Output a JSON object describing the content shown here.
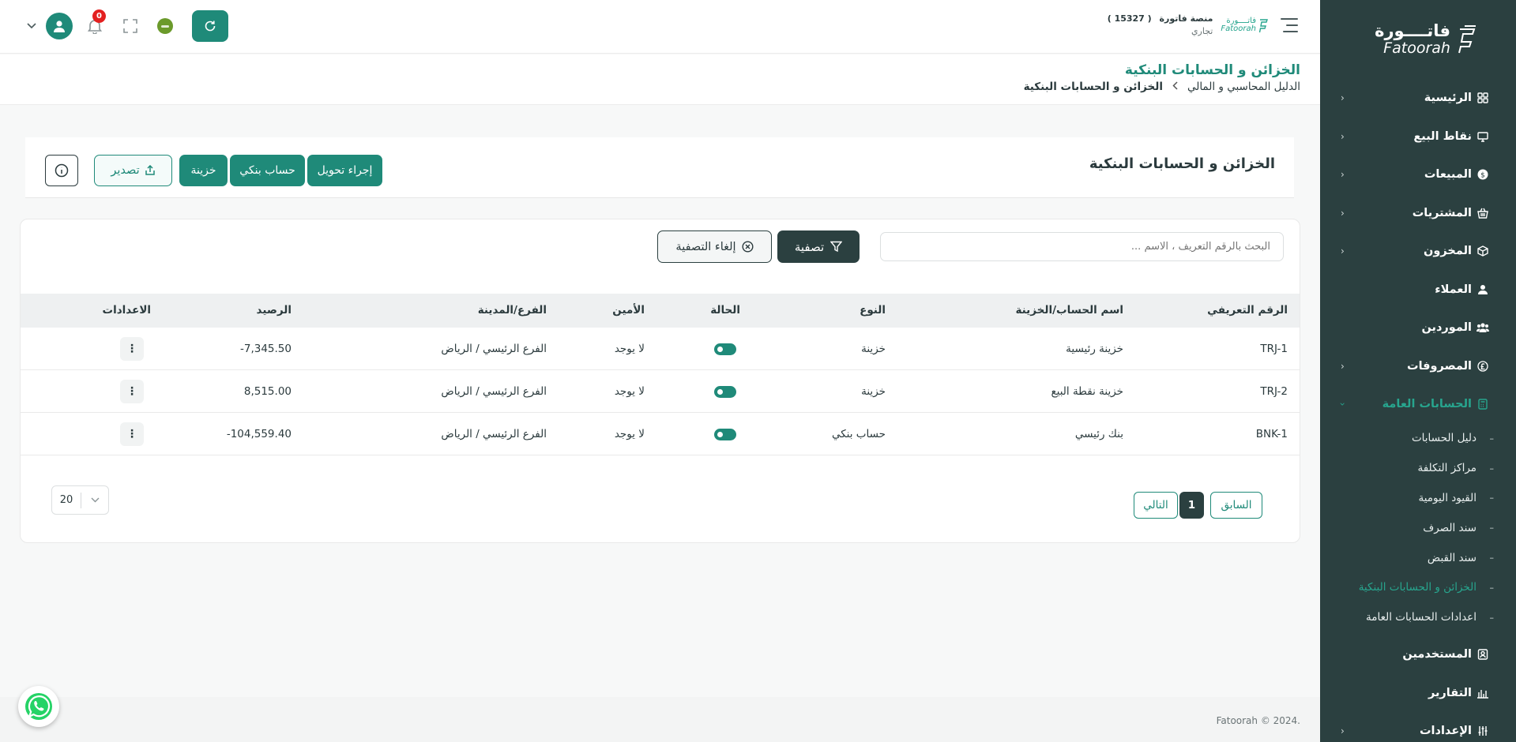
{
  "sidebar": {
    "logo": {
      "ar": "فاتــــورة",
      "en": "Fatoorah"
    },
    "items": [
      {
        "label": "الرئيسية",
        "icon": "grid-icon"
      },
      {
        "label": "نقاط البيع",
        "icon": "monitor-icon"
      },
      {
        "label": "المبيعات",
        "icon": "dollar-icon"
      },
      {
        "label": "المشتريات",
        "icon": "basket-icon"
      },
      {
        "label": "المخزون",
        "icon": "box-icon"
      },
      {
        "label": "العملاء",
        "icon": "user-icon"
      },
      {
        "label": "الموردين",
        "icon": "users-icon"
      },
      {
        "label": "المصروفات",
        "icon": "pound-icon"
      },
      {
        "label": "الحسابات العامة",
        "icon": "calculator-icon"
      },
      {
        "label": "المستخدمين",
        "icon": "user-badge-icon"
      },
      {
        "label": "التقارير",
        "icon": "chart-icon"
      },
      {
        "label": "الإعدادات",
        "icon": "sliders-icon"
      }
    ],
    "sub_items": [
      "دليل الحسابات",
      "مراكز التكلفة",
      "القيود اليومية",
      "سند الصرف",
      "سند القبض",
      "الخزائن و الحسابات البنكية",
      "اعدادات الحسابات العامة"
    ],
    "active_sub": "الخزائن و الحسابات البنكية"
  },
  "topbar": {
    "notifications_count": "0",
    "company_name": "منصة فاتورة",
    "company_id": "( 15327 )",
    "company_type": "تجاري",
    "mini_logo_ar": "فاتــــورة",
    "mini_logo_en": "Fatoorah"
  },
  "page": {
    "title": "الخزائن و الحسابات البنكية",
    "breadcrumb": [
      "الدليل المحاسبي و المالي",
      "الخزائن و الحسابات البنكية"
    ]
  },
  "card": {
    "title": "الخزائن و الحسابات البنكية",
    "buttons": {
      "transfer": "إجراء تحويل",
      "bank_account": "حساب بنكي",
      "treasury": "خزينة",
      "export": "تصدير"
    }
  },
  "filters": {
    "search_placeholder": "البحث بالرقم التعريف ، الاسم ...",
    "filter_label": "تصفية",
    "clear_label": "إلغاء التصفية"
  },
  "table": {
    "headers": [
      "الرقم التعريفي",
      "اسم الحساب/الخزينة",
      "النوع",
      "الحالة",
      "الأمين",
      "الفرع/المدينة",
      "الرصيد",
      "الاعدادات"
    ],
    "rows": [
      {
        "id": "TRJ-1",
        "name": "خزينة رئيسية",
        "type": "خزينة",
        "status": true,
        "custodian": "لا يوجد",
        "branch": "الفرع الرئيسي / الرياض",
        "balance": "-7,345.50"
      },
      {
        "id": "TRJ-2",
        "name": "خزينة نقطة البيع",
        "type": "خزينة",
        "status": true,
        "custodian": "لا يوجد",
        "branch": "الفرع الرئيسي / الرياض",
        "balance": "8,515.00"
      },
      {
        "id": "BNK-1",
        "name": "بنك رئيسي",
        "type": "حساب بنكي",
        "status": true,
        "custodian": "لا يوجد",
        "branch": "الفرع الرئيسي / الرياض",
        "balance": "-104,559.40"
      }
    ]
  },
  "pagination": {
    "prev": "السابق",
    "current": "1",
    "next": "التالي",
    "page_size": "20"
  },
  "footer": {
    "copyright": "Fatoorah © 2024."
  },
  "colors": {
    "primary": "#1f8a79",
    "sidebar": "#2b4040",
    "accent": "#27a58e",
    "badge": "#e32020"
  }
}
